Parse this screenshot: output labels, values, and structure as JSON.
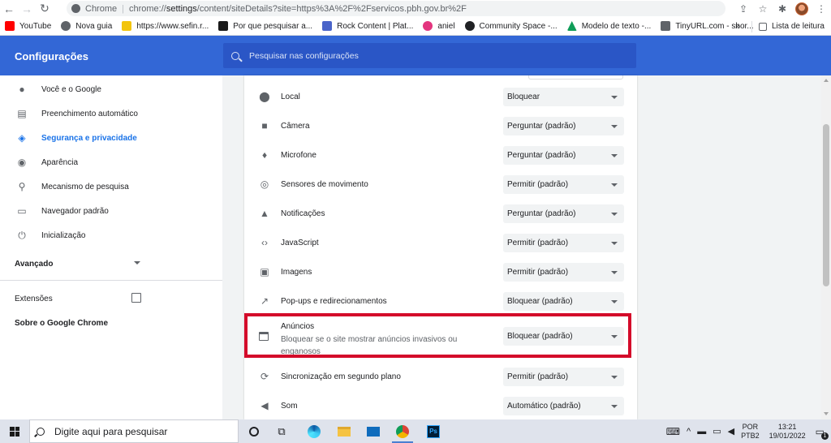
{
  "browser": {
    "chrome_label": "Chrome",
    "url_prefix": "chrome://",
    "url_strong": "settings",
    "url_rest": "/content/siteDetails?site=https%3A%2F%2Fservicos.pbh.gov.br%2F"
  },
  "bookmarks": {
    "items": [
      {
        "label": "YouTube",
        "color": "#ff0000"
      },
      {
        "label": "Nova guia",
        "color": "#5f6368"
      },
      {
        "label": "https://www.sefin.r...",
        "color": "#f2c40e"
      },
      {
        "label": "Por que pesquisar a...",
        "color": "#1a1a1a"
      },
      {
        "label": "Rock Content | Plat...",
        "color": "#4a64c9"
      },
      {
        "label": "aniel",
        "color": "#e3357e"
      },
      {
        "label": "Community Space -...",
        "color": "#202124"
      },
      {
        "label": "Modelo de texto -...",
        "color": "#0f9d58"
      },
      {
        "label": "TinyURL.com - shor...",
        "color": "#5f6368"
      }
    ],
    "overflow": "»",
    "reading_list": "Lista de leitura"
  },
  "header": {
    "title": "Configurações",
    "search_placeholder": "Pesquisar nas configurações"
  },
  "sidebar": {
    "items": [
      {
        "label": "Você e o Google",
        "icon": "person-icon"
      },
      {
        "label": "Preenchimento automático",
        "icon": "clipboard-icon"
      },
      {
        "label": "Segurança e privacidade",
        "icon": "shield-icon"
      },
      {
        "label": "Aparência",
        "icon": "palette-icon"
      },
      {
        "label": "Mecanismo de pesquisa",
        "icon": "search-icon"
      },
      {
        "label": "Navegador padrão",
        "icon": "browser-icon"
      },
      {
        "label": "Inicialização",
        "icon": "power-icon"
      }
    ],
    "advanced": "Avançado",
    "extensions": "Extensões",
    "about": "Sobre o Google Chrome"
  },
  "permissions": [
    {
      "label": "Local",
      "value": "Bloquear",
      "icon": "location-pin-icon"
    },
    {
      "label": "Câmera",
      "value": "Perguntar (padrão)",
      "icon": "camera-icon"
    },
    {
      "label": "Microfone",
      "value": "Perguntar (padrão)",
      "icon": "microphone-icon"
    },
    {
      "label": "Sensores de movimento",
      "value": "Permitir (padrão)",
      "icon": "motion-sensor-icon"
    },
    {
      "label": "Notificações",
      "value": "Perguntar (padrão)",
      "icon": "bell-icon"
    },
    {
      "label": "JavaScript",
      "value": "Permitir (padrão)",
      "icon": "code-icon"
    },
    {
      "label": "Imagens",
      "value": "Permitir (padrão)",
      "icon": "image-icon"
    },
    {
      "label": "Pop-ups e redirecionamentos",
      "value": "Bloquear (padrão)",
      "icon": "external-link-icon"
    },
    {
      "label": "Sincronização em segundo plano",
      "value": "Permitir (padrão)",
      "icon": "sync-icon"
    },
    {
      "label": "Som",
      "value": "Automático (padrão)",
      "icon": "speaker-icon"
    }
  ],
  "ads": {
    "title": "Anúncios",
    "description": "Bloquear se o site mostrar anúncios invasivos ou enganosos",
    "value": "Bloquear (padrão)"
  },
  "taskbar": {
    "search_placeholder": "Digite aqui para pesquisar",
    "lang_top": "POR",
    "lang_bottom": "PTB2",
    "time": "13:21",
    "date": "19/01/2022",
    "notification_count": "1"
  }
}
